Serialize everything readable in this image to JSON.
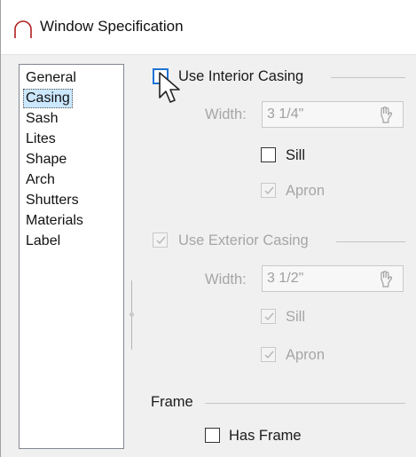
{
  "window": {
    "title": "Window Specification",
    "app_icon": "arch-icon"
  },
  "nav": {
    "items": [
      {
        "label": "General",
        "selected": false
      },
      {
        "label": "Casing",
        "selected": true
      },
      {
        "label": "Sash",
        "selected": false
      },
      {
        "label": "Lites",
        "selected": false
      },
      {
        "label": "Shape",
        "selected": false
      },
      {
        "label": "Arch",
        "selected": false
      },
      {
        "label": "Shutters",
        "selected": false
      },
      {
        "label": "Materials",
        "selected": false
      },
      {
        "label": "Label",
        "selected": false
      }
    ]
  },
  "interior": {
    "use_label": "Use Interior Casing",
    "use_checked": false,
    "width_label": "Width:",
    "width_value": "3 1/4\"",
    "sill_label": "Sill",
    "sill_checked": false,
    "apron_label": "Apron",
    "apron_checked": true
  },
  "exterior": {
    "use_label": "Use Exterior Casing",
    "use_checked": true,
    "width_label": "Width:",
    "width_value": "3 1/2\"",
    "sill_label": "Sill",
    "sill_checked": true,
    "apron_label": "Apron",
    "apron_checked": true
  },
  "frame": {
    "group_label": "Frame",
    "has_frame_label": "Has Frame",
    "has_frame_checked": false
  },
  "icons": {
    "width_picker": "hand-pointer-icon",
    "cursor": "mouse-pointer-icon"
  },
  "colors": {
    "selection": "#cce8ff",
    "focus": "#1e73d6",
    "disabled_text": "#a6a6a6"
  }
}
